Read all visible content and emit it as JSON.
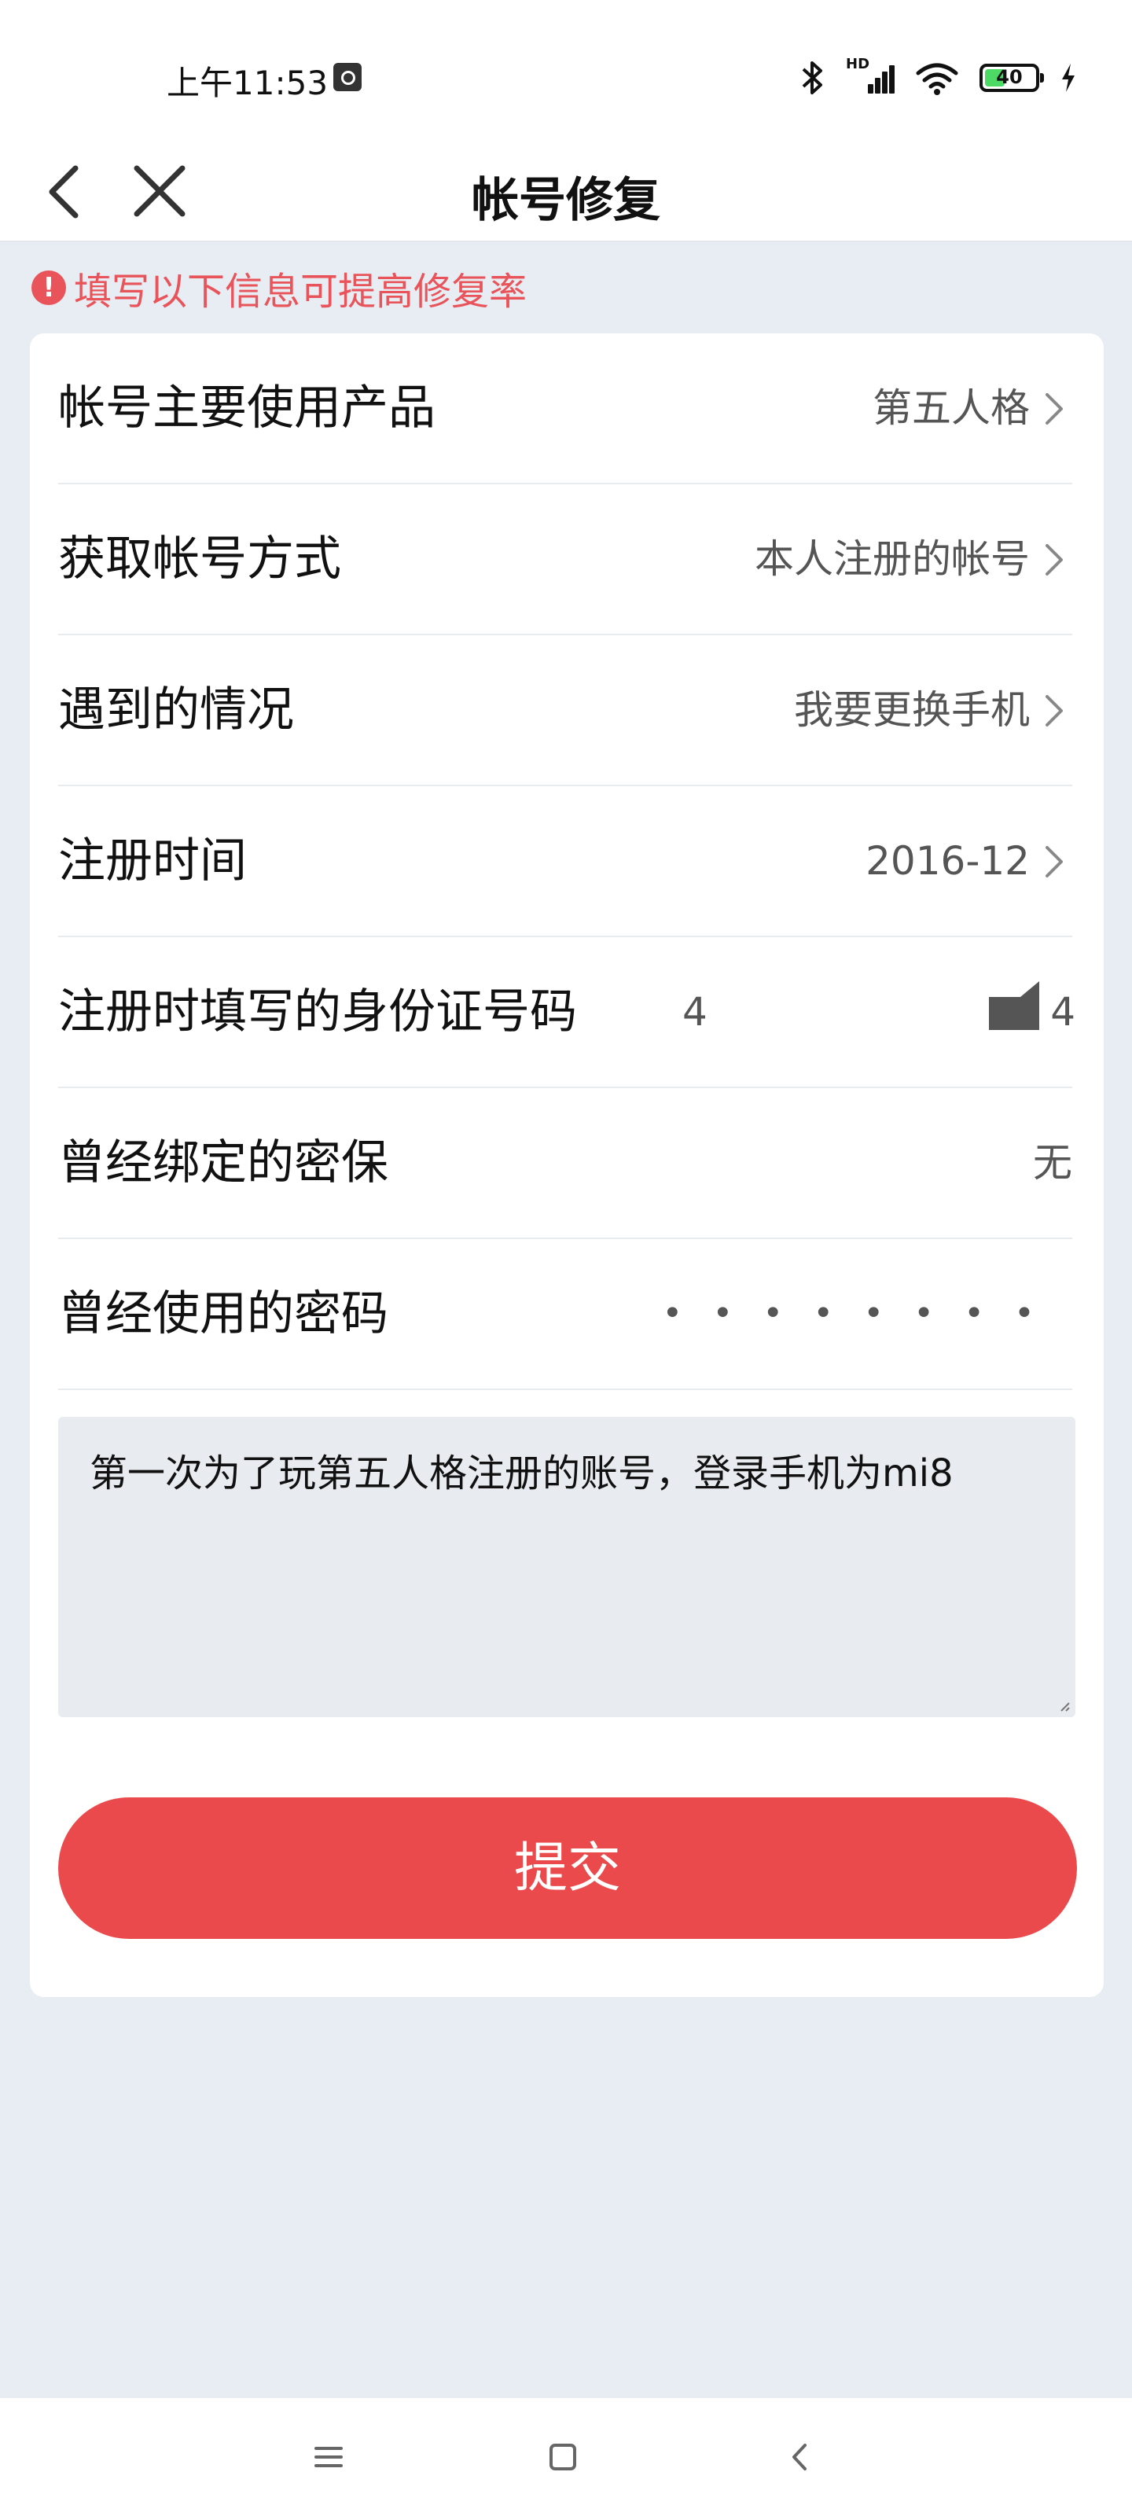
{
  "status_bar": {
    "time": "上午11:53",
    "hd_label": "HD",
    "battery_level": "40",
    "battery_fraction": 0.4,
    "battery_color": "#4cd964"
  },
  "header": {
    "title": "帐号修复",
    "back_icon": "chevron-left-icon",
    "close_icon": "close-icon"
  },
  "notice": {
    "icon": "alert-circle-icon",
    "text": "填写以下信息可提高修复率",
    "color": "#e8545a"
  },
  "form": {
    "rows": [
      {
        "label": "帐号主要使用产品",
        "value": "第五人格"
      },
      {
        "label": "获取帐号方式",
        "value": "本人注册的帐号"
      },
      {
        "label": "遇到的情况",
        "value": "我要更换手机"
      },
      {
        "label": "注册时间",
        "value": "2016-12"
      },
      {
        "label": "注册时填写的身份证号码",
        "value_start": "4",
        "value_end": "4"
      },
      {
        "label": "曾经绑定的密保",
        "value": "无"
      },
      {
        "label": "曾经使用的密码",
        "value": "••••••••"
      }
    ],
    "note_text": "第一次为了玩第五人格注册的账号，登录手机为mi8",
    "submit_label": "提交",
    "submit_color": "#ea4a4c"
  },
  "nav_bar": {
    "menu_icon": "menu-icon",
    "home_icon": "home-square-icon",
    "back_icon": "back-triangle-icon"
  }
}
